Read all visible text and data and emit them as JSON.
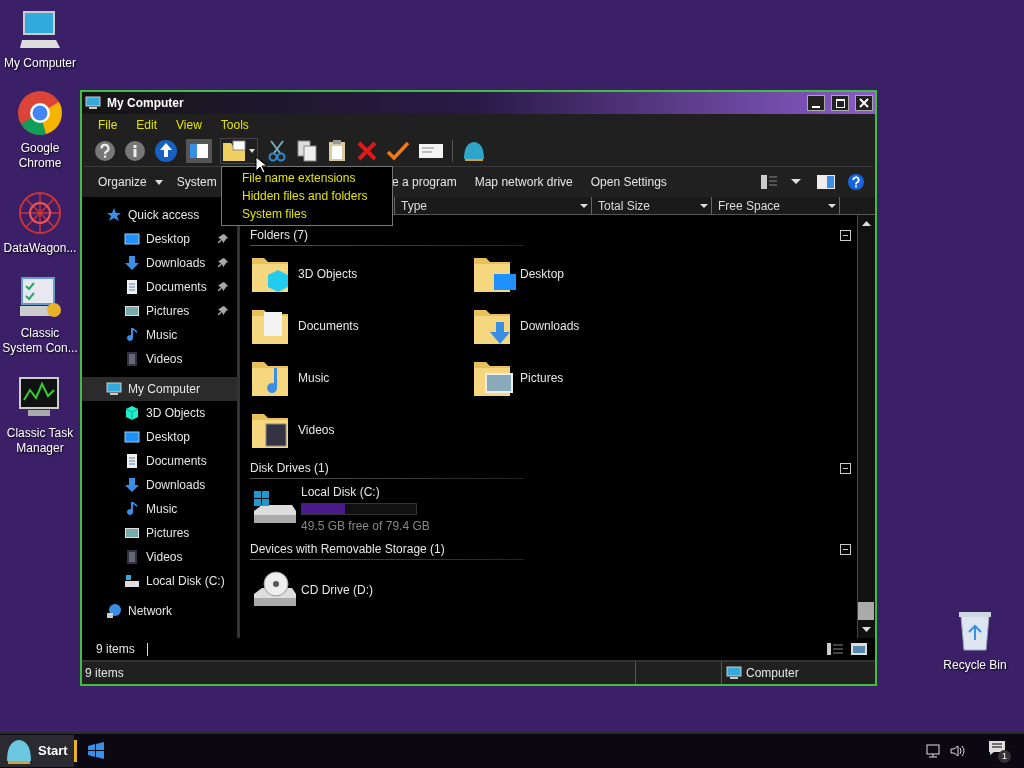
{
  "desktop_icons": [
    {
      "label": "My Computer",
      "kind": "computer"
    },
    {
      "label": "Google Chrome",
      "kind": "chrome"
    },
    {
      "label": "DataWagon...",
      "kind": "web"
    },
    {
      "label": "Classic System Con...",
      "kind": "control"
    },
    {
      "label": "Classic Task Manager",
      "kind": "task"
    }
  ],
  "recycle_bin": {
    "label": "Recycle Bin"
  },
  "window": {
    "title": "My Computer",
    "menu": [
      "File",
      "Edit",
      "View",
      "Tools"
    ],
    "dropdown": {
      "items": [
        "File name extensions",
        "Hidden files and folders",
        "System files"
      ]
    },
    "command_bar": [
      {
        "label": "Organize",
        "caret": true
      },
      {
        "label": "System",
        "caret": false
      },
      {
        "label": "e a program",
        "caret": false
      },
      {
        "label": "Map network drive",
        "caret": false
      },
      {
        "label": "Open Settings",
        "caret": false
      }
    ],
    "columns": [
      {
        "label": "Type"
      },
      {
        "label": "Total Size"
      },
      {
        "label": "Free Space"
      }
    ],
    "nav": [
      {
        "label": "Quick access",
        "kind": "star",
        "selected": false,
        "children": [
          {
            "label": "Desktop",
            "kind": "desktop",
            "pinned": true,
            "selected": false
          },
          {
            "label": "Downloads",
            "kind": "downloads",
            "pinned": true,
            "selected": false
          },
          {
            "label": "Documents",
            "kind": "documents",
            "pinned": true,
            "selected": false
          },
          {
            "label": "Pictures",
            "kind": "pictures",
            "pinned": true,
            "selected": false
          },
          {
            "label": "Music",
            "kind": "music",
            "pinned": false,
            "selected": false
          },
          {
            "label": "Videos",
            "kind": "videos",
            "pinned": false,
            "selected": false
          }
        ]
      },
      {
        "label": "My Computer",
        "kind": "computer",
        "selected": true,
        "children": [
          {
            "label": "3D Objects",
            "kind": "cube",
            "pinned": false,
            "selected": false
          },
          {
            "label": "Desktop",
            "kind": "desktop",
            "pinned": false,
            "selected": false
          },
          {
            "label": "Documents",
            "kind": "documents",
            "pinned": false,
            "selected": false
          },
          {
            "label": "Downloads",
            "kind": "downloads",
            "pinned": false,
            "selected": false
          },
          {
            "label": "Music",
            "kind": "music",
            "pinned": false,
            "selected": false
          },
          {
            "label": "Pictures",
            "kind": "pictures",
            "pinned": false,
            "selected": false
          },
          {
            "label": "Videos",
            "kind": "videos",
            "pinned": false,
            "selected": false
          },
          {
            "label": "Local Disk (C:)",
            "kind": "disk",
            "pinned": false,
            "selected": false
          }
        ]
      },
      {
        "label": "Network",
        "kind": "network",
        "selected": false
      }
    ],
    "groups": [
      {
        "title": "Folders (7)",
        "kind": "folders",
        "items": [
          {
            "name": "3D Objects",
            "kind": "cube"
          },
          {
            "name": "Desktop",
            "kind": "desktop"
          },
          {
            "name": "Documents",
            "kind": "documents"
          },
          {
            "name": "Downloads",
            "kind": "downloads"
          },
          {
            "name": "Music",
            "kind": "music"
          },
          {
            "name": "Pictures",
            "kind": "pictures"
          },
          {
            "name": "Videos",
            "kind": "videos"
          }
        ]
      },
      {
        "title": "Disk Drives (1)",
        "kind": "drives",
        "items": [
          {
            "name": "Local Disk (C:)",
            "kind": "disk",
            "level": 0.38,
            "detail": "49.5 GB free of 79.4 GB"
          }
        ]
      },
      {
        "title": "Devices with Removable Storage (1)",
        "kind": "drives",
        "items": [
          {
            "name": "CD Drive (D:)",
            "kind": "cd"
          }
        ]
      }
    ],
    "item_count": "9 items",
    "status_bar": {
      "count": "9 items",
      "location": "Computer"
    }
  },
  "taskbar": {
    "start": "Start",
    "notifications": "1"
  }
}
